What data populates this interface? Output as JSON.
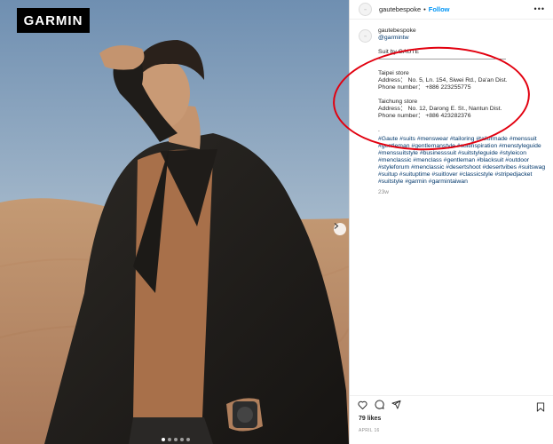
{
  "photo": {
    "brand_label": "GARMIN",
    "slide_count": 5,
    "active_slide": 0
  },
  "header": {
    "username": "gautebespoke",
    "separator": "•",
    "follow_label": "Follow",
    "more_label": "•••"
  },
  "caption": {
    "username": "gautebespoke",
    "tag": "@garmintw",
    "lines": [
      "Suit by GAUTE",
      "————————————————————————",
      "",
      "Taipei store",
      "Address： No. 5, Ln. 154, Siwei Rd., Da'an Dist.",
      "Phone number： +886 223255775",
      "",
      "Taichung store",
      "Address： No. 12, Darong E. St., Nantun Dist.",
      "Phone number： +886 423282376",
      "",
      "."
    ],
    "hashtags": "#Gaute #suits #menswear #tailoring #tailormade #menssuit #gentleman #gentlemanstyle #suitinspiration #menstyleguide #menssuitstyle #businesssuit #suitstyleguide #styleicon #menclassic #menclass #gentleman #blacksuit #outdoor #styleforum #menclassic #desertshoot #desertvibes #suitswag #suitup #suituptime #suitlover #classicstyle #stripedjacket #suitstyle #garmin #garmintaiwan",
    "age": "23w"
  },
  "footer": {
    "likes": "79 likes",
    "date": "APRIL 16"
  },
  "annotation_color": "#e2000f",
  "accent": "#0095f6",
  "icons": [
    "heart-icon",
    "comment-icon",
    "share-icon",
    "bookmark-icon",
    "chevron-right-icon"
  ]
}
